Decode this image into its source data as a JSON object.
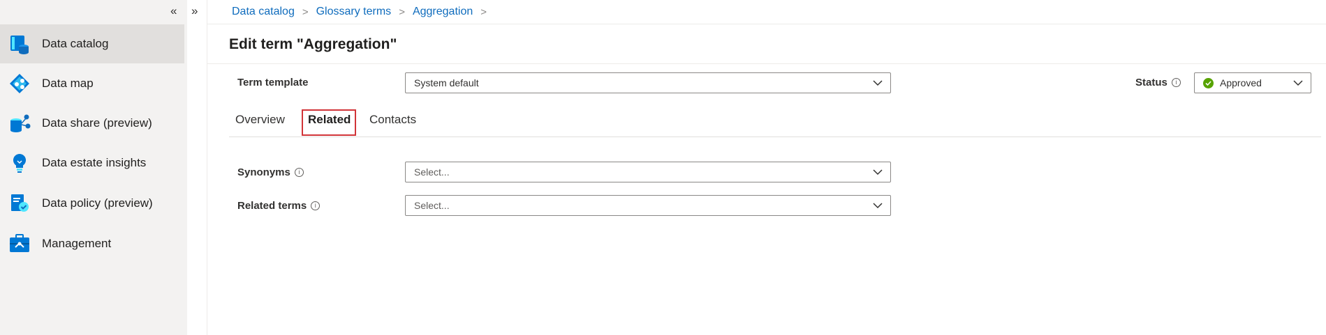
{
  "sidebar": {
    "collapse_glyph": "«",
    "items": [
      {
        "label": "Data catalog",
        "icon": "data-catalog-icon",
        "selected": true
      },
      {
        "label": "Data map",
        "icon": "data-map-icon"
      },
      {
        "label": "Data share (preview)",
        "icon": "data-share-icon"
      },
      {
        "label": "Data estate insights",
        "icon": "lightbulb-icon"
      },
      {
        "label": "Data policy (preview)",
        "icon": "data-policy-icon"
      },
      {
        "label": "Management",
        "icon": "toolbox-icon"
      }
    ]
  },
  "strip": {
    "expand_glyph": "»"
  },
  "breadcrumb": {
    "items": [
      "Data catalog",
      "Glossary terms",
      "Aggregation"
    ],
    "separator": ">"
  },
  "page": {
    "title": "Edit term \"Aggregation\""
  },
  "term_template": {
    "label": "Term template",
    "value": "System default"
  },
  "status": {
    "label": "Status",
    "value": "Approved",
    "color": "#57a300"
  },
  "tabs": [
    {
      "label": "Overview"
    },
    {
      "label": "Related",
      "active": true
    },
    {
      "label": "Contacts"
    }
  ],
  "related": {
    "synonyms": {
      "label": "Synonyms",
      "placeholder": "Select..."
    },
    "related_terms": {
      "label": "Related terms",
      "placeholder": "Select..."
    }
  },
  "colors": {
    "accent": "#0f6cbd",
    "highlight": "#d13438",
    "nav_bg": "#f3f2f1"
  }
}
